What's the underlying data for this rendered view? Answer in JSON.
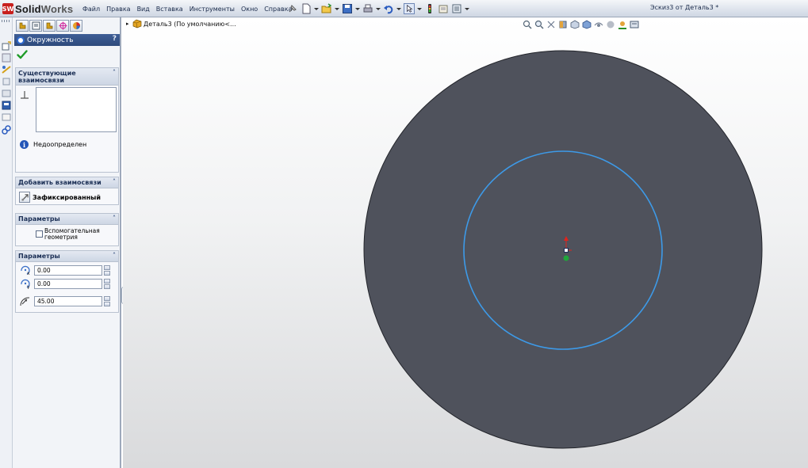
{
  "app": {
    "logo_prefix": "Solid",
    "logo_suffix": "Works",
    "badge": "SW",
    "document_title": "Эскиз3 от Деталь3 *"
  },
  "menu": [
    "Файл",
    "Правка",
    "Вид",
    "Вставка",
    "Инструменты",
    "Окно",
    "Справка"
  ],
  "panel": {
    "title": "Окружность",
    "help": "?",
    "groups": {
      "existing_relations": {
        "title": "Существующие взаимосвязи",
        "status": "Недоопределен"
      },
      "add_relations": {
        "title": "Добавить взаимосвязи",
        "fixed_label": "Зафиксированный"
      },
      "options": {
        "title": "Параметры",
        "construction_label": "Вспомогательная геометрия",
        "construction_checked": false
      },
      "parameters": {
        "title": "Параметры",
        "center_x": "0.00",
        "center_y": "0.00",
        "radius": "45.00"
      }
    }
  },
  "tree": {
    "label": "Деталь3  (По умолчанию<..."
  },
  "colors": {
    "solid_body": "#4f525c",
    "sketch_circle": "#3d9ae8",
    "panel_header": "#2e4a7c"
  }
}
